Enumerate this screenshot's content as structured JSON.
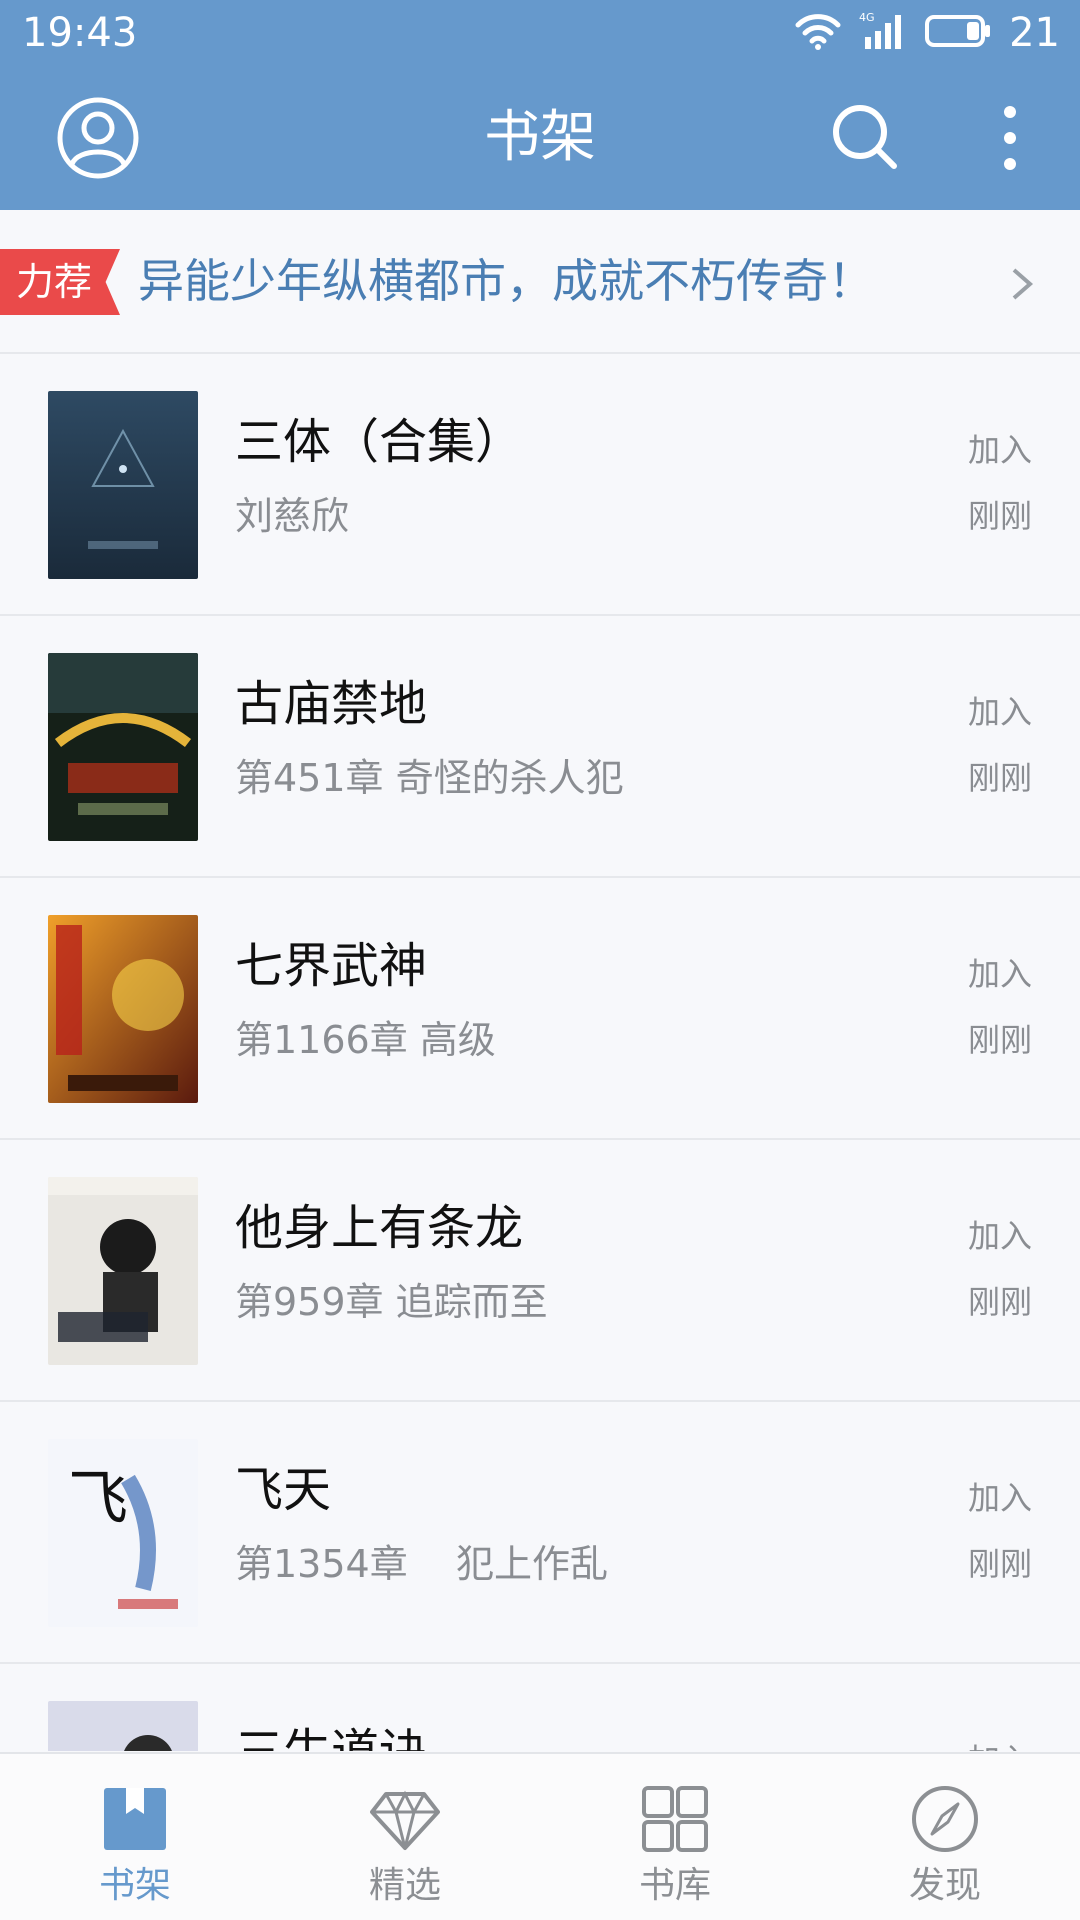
{
  "status": {
    "time": "19:43",
    "battery": "21",
    "network": "4G"
  },
  "appbar": {
    "title": "书架"
  },
  "promo": {
    "tag": "力荐",
    "text": "异能少年纵横都市，成就不朽传奇！"
  },
  "books": [
    {
      "title": "三体（合集）",
      "subtitle": "刘慈欣",
      "added": "加入",
      "time": "刚刚"
    },
    {
      "title": "古庙禁地",
      "subtitle": "第451章 奇怪的杀人犯",
      "added": "加入",
      "time": "刚刚"
    },
    {
      "title": "七界武神",
      "subtitle": "第1166章 高级",
      "added": "加入",
      "time": "刚刚"
    },
    {
      "title": "他身上有条龙",
      "subtitle": "第959章 追踪而至",
      "added": "加入",
      "time": "刚刚"
    },
    {
      "title": "飞天",
      "subtitle": "第1354章    犯上作乱",
      "added": "加入",
      "time": "刚刚"
    },
    {
      "title": "三生道诀",
      "subtitle": "",
      "added": "加入",
      "time": ""
    }
  ],
  "tabs": [
    {
      "label": "书架",
      "icon": "bookmark-icon",
      "active": true
    },
    {
      "label": "精选",
      "icon": "diamond-icon",
      "active": false
    },
    {
      "label": "书库",
      "icon": "grid-icon",
      "active": false
    },
    {
      "label": "发现",
      "icon": "compass-icon",
      "active": false
    }
  ],
  "colors": {
    "primary": "#6699cc",
    "promo_tag": "#ea4a4a",
    "promo_text": "#4a7eb3"
  }
}
